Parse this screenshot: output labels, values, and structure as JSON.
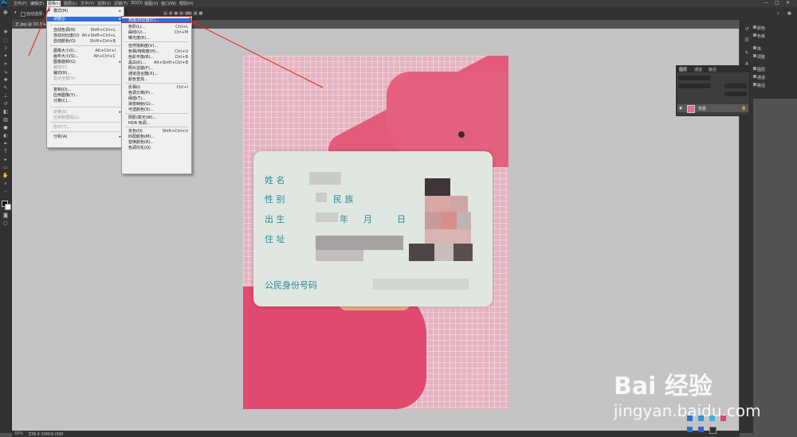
{
  "menubar": {
    "items": [
      "文件(F)",
      "编辑(E)",
      "图像(I)",
      "图层(L)",
      "文字(Y)",
      "选择(S)",
      "滤镜(T)",
      "3D(D)",
      "视图(V)",
      "窗口(W)",
      "帮助(H)"
    ],
    "logo": "Ps"
  },
  "options": {
    "auto_select": "自动选择：",
    "window_controls": [
      "—",
      "□",
      "✕"
    ]
  },
  "document": {
    "tab_label": "正.jpg @ 33.3%(R..."
  },
  "status": {
    "zoom": "33%",
    "info": "文档:9.00M/9.00M"
  },
  "image_menu": {
    "items": [
      {
        "label": "模式(M)",
        "shortcut": "",
        "submenu": true,
        "disabled": false
      },
      {
        "label": "调整(J)",
        "shortcut": "",
        "submenu": true,
        "disabled": false,
        "highlighted": true
      },
      {
        "label": "自动色调(N)",
        "shortcut": "Shift+Ctrl+L",
        "submenu": false,
        "disabled": false
      },
      {
        "label": "自动对比度(U)",
        "shortcut": "Alt+Shift+Ctrl+L",
        "submenu": false,
        "disabled": false
      },
      {
        "label": "自动颜色(O)",
        "shortcut": "Shift+Ctrl+B",
        "submenu": false,
        "disabled": false
      },
      {
        "label": "图像大小(I)...",
        "shortcut": "Alt+Ctrl+I",
        "submenu": false,
        "disabled": false
      },
      {
        "label": "画布大小(S)...",
        "shortcut": "Alt+Ctrl+C",
        "submenu": false,
        "disabled": false
      },
      {
        "label": "图像旋转(G)",
        "shortcut": "",
        "submenu": true,
        "disabled": false
      },
      {
        "label": "裁剪(P)",
        "shortcut": "",
        "submenu": false,
        "disabled": true
      },
      {
        "label": "裁切(R)...",
        "shortcut": "",
        "submenu": false,
        "disabled": false
      },
      {
        "label": "显示全部(V)",
        "shortcut": "",
        "submenu": false,
        "disabled": true
      },
      {
        "label": "复制(D)...",
        "shortcut": "",
        "submenu": false,
        "disabled": false
      },
      {
        "label": "应用图像(Y)...",
        "shortcut": "",
        "submenu": false,
        "disabled": false
      },
      {
        "label": "计算(C)...",
        "shortcut": "",
        "submenu": false,
        "disabled": false
      },
      {
        "label": "变量(B)",
        "shortcut": "",
        "submenu": true,
        "disabled": true
      },
      {
        "label": "应用数据组(L)...",
        "shortcut": "",
        "submenu": false,
        "disabled": true
      },
      {
        "label": "陷印(T)...",
        "shortcut": "",
        "submenu": false,
        "disabled": true
      },
      {
        "label": "分析(A)",
        "shortcut": "",
        "submenu": true,
        "disabled": false
      }
    ]
  },
  "adjust_menu": {
    "items": [
      {
        "label": "亮度/对比度(C)...",
        "shortcut": "",
        "highlighted": true
      },
      {
        "label": "色阶(L)...",
        "shortcut": "Ctrl+L"
      },
      {
        "label": "曲线(U)...",
        "shortcut": "Ctrl+M"
      },
      {
        "label": "曝光度(E)...",
        "shortcut": ""
      },
      {
        "label": "自然饱和度(V)...",
        "shortcut": ""
      },
      {
        "label": "色相/饱和度(H)...",
        "shortcut": "Ctrl+U"
      },
      {
        "label": "色彩平衡(B)...",
        "shortcut": "Ctrl+B"
      },
      {
        "label": "黑白(K)...",
        "shortcut": "Alt+Shift+Ctrl+B"
      },
      {
        "label": "照片滤镜(F)...",
        "shortcut": ""
      },
      {
        "label": "通道混合器(X)...",
        "shortcut": ""
      },
      {
        "label": "颜色查找...",
        "shortcut": ""
      },
      {
        "label": "反相(I)",
        "shortcut": "Ctrl+I"
      },
      {
        "label": "色调分离(P)...",
        "shortcut": ""
      },
      {
        "label": "阈值(T)...",
        "shortcut": ""
      },
      {
        "label": "渐变映射(G)...",
        "shortcut": ""
      },
      {
        "label": "可选颜色(S)...",
        "shortcut": ""
      },
      {
        "label": "阴影/高光(W)...",
        "shortcut": ""
      },
      {
        "label": "HDR 色调...",
        "shortcut": ""
      },
      {
        "label": "去色(D)",
        "shortcut": "Shift+Ctrl+U"
      },
      {
        "label": "匹配颜色(M)...",
        "shortcut": ""
      },
      {
        "label": "替换颜色(R)...",
        "shortcut": ""
      },
      {
        "label": "色调均化(Q)",
        "shortcut": ""
      }
    ]
  },
  "right_panel": {
    "items": [
      "颜色",
      "色板",
      "库",
      "调整",
      "图层",
      "通道",
      "路径"
    ]
  },
  "layers_panel": {
    "tabs": [
      "图层",
      "通道",
      "路径"
    ],
    "layer_name": "背景"
  },
  "id_card": {
    "name_label": "姓 名",
    "gender_label": "性 别",
    "ethnicity_label": "民 族",
    "birth_label": "出 生",
    "year_label": "年",
    "month_label": "月",
    "day_label": "日",
    "address_label": "住 址",
    "id_label": "公民身份号码"
  },
  "watermark": {
    "brand": "Bai 经验",
    "url": "jingyan.baidu.com"
  }
}
